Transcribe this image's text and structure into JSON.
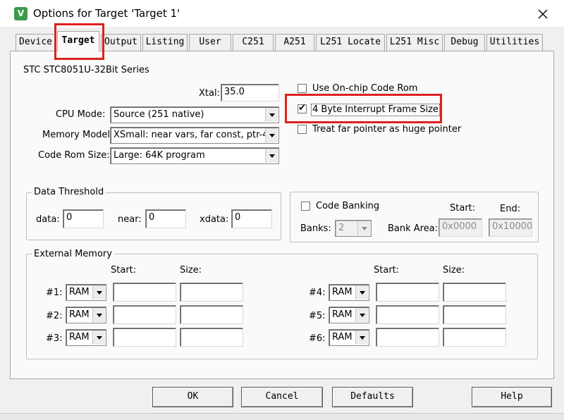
{
  "window": {
    "title": "Options for Target 'Target 1'",
    "app_icon_glyph": "V"
  },
  "tabs": [
    {
      "label": "Device"
    },
    {
      "label": "Target"
    },
    {
      "label": "Output"
    },
    {
      "label": "Listing"
    },
    {
      "label": "User"
    },
    {
      "label": "C251"
    },
    {
      "label": "A251"
    },
    {
      "label": "L251 Locate"
    },
    {
      "label": "L251 Misc"
    },
    {
      "label": "Debug"
    },
    {
      "label": "Utilities"
    }
  ],
  "active_tab": "Target",
  "device_series": "STC STC8051U-32Bit Series",
  "xtal": {
    "label": "Xtal:",
    "value": "35.0"
  },
  "cpu_mode": {
    "label": "CPU Mode:",
    "value": "Source (251 native)"
  },
  "memory_model": {
    "label": "Memory Model:",
    "value": "XSmall: near vars, far const, ptr-4"
  },
  "code_rom_size": {
    "label": "Code Rom Size:",
    "value": "Large: 64K program"
  },
  "options": {
    "use_onchip_code_rom": {
      "label": "Use On-chip Code Rom",
      "checked": false
    },
    "four_byte_interrupt": {
      "label": "4 Byte Interrupt Frame Size",
      "checked": true
    },
    "treat_far_pointer": {
      "label": "Treat far pointer as huge pointer",
      "checked": false
    }
  },
  "data_threshold": {
    "title": "Data Threshold",
    "data_label": "data:",
    "data_value": "0",
    "near_label": "near:",
    "near_value": "0",
    "xdata_label": "xdata:",
    "xdata_value": "0"
  },
  "code_banking": {
    "label": "Code Banking",
    "checked": false,
    "banks_label": "Banks:",
    "banks_value": "2",
    "bank_area_label": "Bank Area:",
    "start_label": "Start:",
    "end_label": "End:",
    "start_value": "0x0000",
    "end_value": "0x10000"
  },
  "external_memory": {
    "title": "External Memory",
    "start_header": "Start:",
    "size_header": "Size:",
    "rows": [
      {
        "label": "#1:",
        "type": "RAM",
        "start": "",
        "size": ""
      },
      {
        "label": "#2:",
        "type": "RAM",
        "start": "",
        "size": ""
      },
      {
        "label": "#3:",
        "type": "RAM",
        "start": "",
        "size": ""
      },
      {
        "label": "#4:",
        "type": "RAM",
        "start": "",
        "size": ""
      },
      {
        "label": "#5:",
        "type": "RAM",
        "start": "",
        "size": ""
      },
      {
        "label": "#6:",
        "type": "RAM",
        "start": "",
        "size": ""
      }
    ]
  },
  "buttons": {
    "ok": "OK",
    "cancel": "Cancel",
    "defaults": "Defaults",
    "help": "Help"
  },
  "colors": {
    "highlight": "#e02020",
    "panel": "#fafafa",
    "window_bg": "#f0f0f0"
  }
}
